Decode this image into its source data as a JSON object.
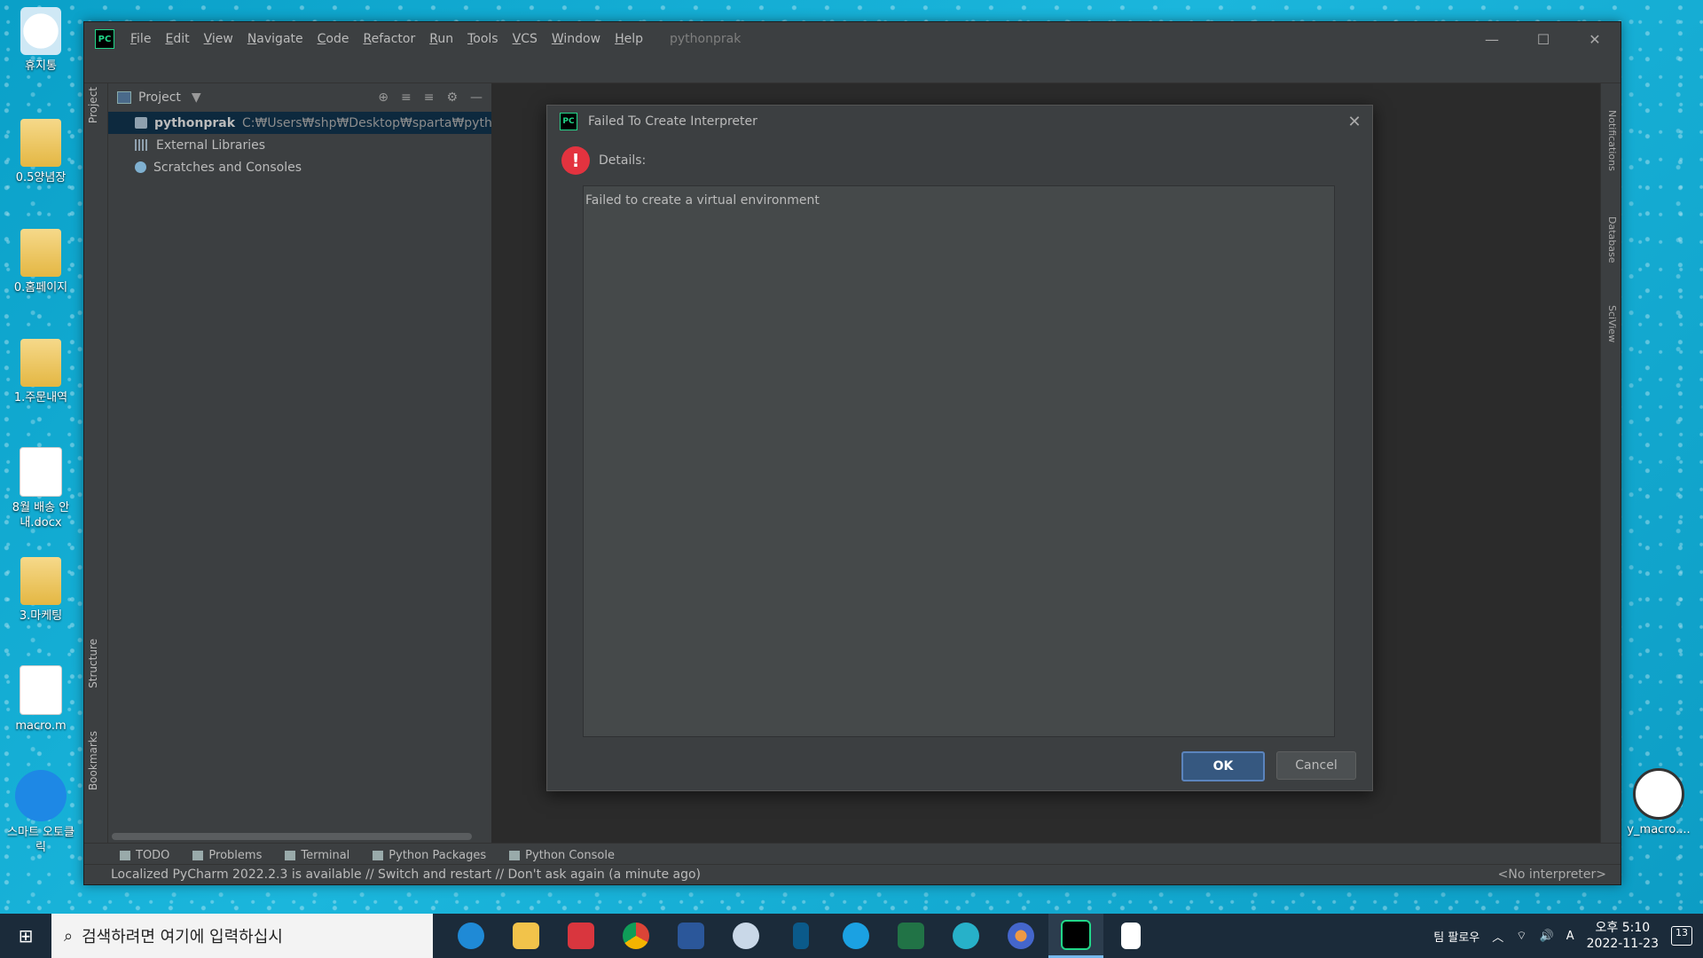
{
  "desktop": {
    "icons": [
      {
        "label": "휴지통",
        "kind": "recycle"
      },
      {
        "label": "0.5양념장",
        "kind": "folder"
      },
      {
        "label": "0.홈페이지",
        "kind": "folder"
      },
      {
        "label": "1.주문내역",
        "kind": "folder"
      },
      {
        "label": "8월 배송 안내.docx",
        "kind": "doc"
      },
      {
        "label": "3.마케팅",
        "kind": "folder"
      },
      {
        "label": "macro.m",
        "kind": "doc"
      },
      {
        "label": "스마트 오토클릭",
        "kind": "cursor"
      }
    ],
    "right_icon_label": "y_macro...."
  },
  "ide": {
    "menu": [
      "File",
      "Edit",
      "View",
      "Navigate",
      "Code",
      "Refactor",
      "Run",
      "Tools",
      "VCS",
      "Window",
      "Help"
    ],
    "window_title": "pythonprak",
    "logo_text": "PC",
    "left_tabs": {
      "project": "Project",
      "structure": "Structure",
      "bookmarks": "Bookmarks"
    },
    "right_tabs": {
      "notifications": "Notifications",
      "database": "Database",
      "sciview": "SciView"
    },
    "project_panel": {
      "title": "Project",
      "tree": {
        "root_name": "pythonprak",
        "root_path": "C:₩Users₩shp₩Desktop₩sparta₩pythonpra",
        "external_libraries": "External Libraries",
        "scratches": "Scratches and Consoles"
      }
    },
    "bottom_tabs": [
      "TODO",
      "Problems",
      "Terminal",
      "Python Packages",
      "Python Console"
    ],
    "status_message": "Localized PyCharm 2022.2.3 is available // Switch and restart // Don't ask again (a minute ago)",
    "interpreter": "<No interpreter>"
  },
  "dialog": {
    "title": "Failed To Create Interpreter",
    "details_label": "Details:",
    "error_glyph": "!",
    "details_text": "Failed to create a virtual environment",
    "ok_label": "OK",
    "cancel_label": "Cancel"
  },
  "taskbar": {
    "search_placeholder": "검색하려면 여기에 입력하십시",
    "team_label": "팀 팔로우",
    "ime": "A",
    "time": "오후 5:10",
    "date": "2022-11-23",
    "notif_count": "13"
  }
}
